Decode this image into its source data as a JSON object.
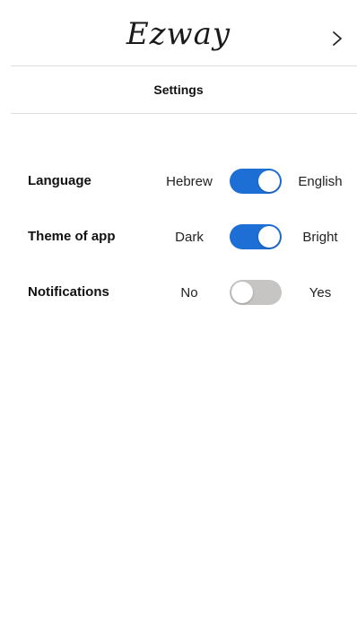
{
  "header": {
    "logo": "Ezway",
    "next_icon": "chevron-right-icon"
  },
  "page_title": "Settings",
  "settings": [
    {
      "label": "Language",
      "left_option": "Hebrew",
      "right_option": "English",
      "enabled": true
    },
    {
      "label": "Theme of app",
      "left_option": "Dark",
      "right_option": "Bright",
      "enabled": true
    },
    {
      "label": "Notifications",
      "left_option": "No",
      "right_option": "Yes",
      "enabled": false
    }
  ],
  "colors": {
    "toggle_on": "#1d6fd6",
    "toggle_off": "#c7c4c4"
  }
}
